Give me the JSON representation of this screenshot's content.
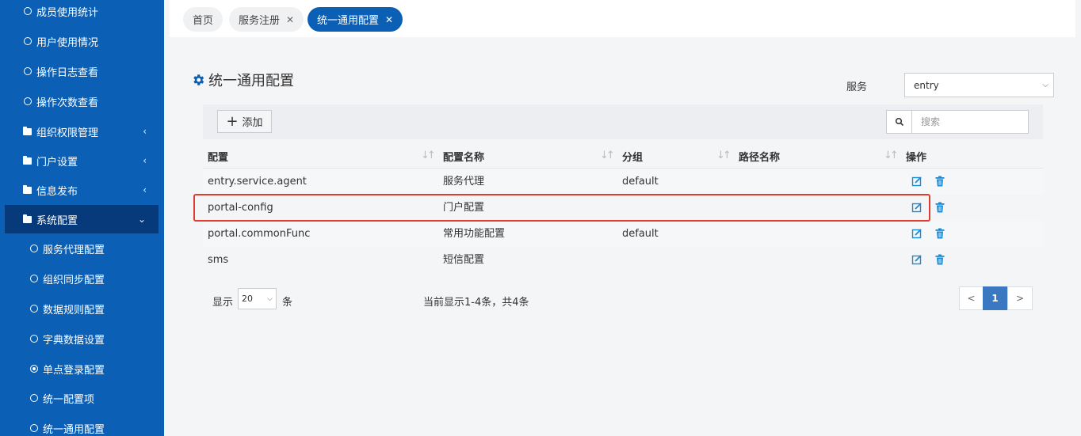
{
  "sidebar": {
    "items": [
      {
        "label": "成员使用统计",
        "type": "sub"
      },
      {
        "label": "用户使用情况",
        "type": "sub"
      },
      {
        "label": "操作日志查看",
        "type": "sub"
      },
      {
        "label": "操作次数查看",
        "type": "sub"
      },
      {
        "label": "组织权限管理",
        "type": "group",
        "chevron": "‹"
      },
      {
        "label": "门户设置",
        "type": "group",
        "chevron": "‹"
      },
      {
        "label": "信息发布",
        "type": "group",
        "chevron": "‹"
      },
      {
        "label": "系统配置",
        "type": "group",
        "chevron": "⌄",
        "active": true
      },
      {
        "label": "服务代理配置",
        "type": "sub2"
      },
      {
        "label": "组织同步配置",
        "type": "sub2"
      },
      {
        "label": "数据规则配置",
        "type": "sub2"
      },
      {
        "label": "字典数据设置",
        "type": "sub2"
      },
      {
        "label": "单点登录配置",
        "type": "sub2"
      },
      {
        "label": "统一配置项",
        "type": "sub2"
      },
      {
        "label": "统一通用配置",
        "type": "sub2"
      }
    ]
  },
  "tabs": [
    {
      "label": "首页",
      "closable": false
    },
    {
      "label": "服务注册",
      "closable": true
    },
    {
      "label": "统一通用配置",
      "closable": true,
      "active": true
    }
  ],
  "page": {
    "title": "统一通用配置",
    "service_label": "服务",
    "service_value": "entry",
    "add_label": "添加",
    "search_placeholder": "搜索"
  },
  "table": {
    "columns": [
      "配置",
      "配置名称",
      "分组",
      "路径名称",
      "操作"
    ],
    "rows": [
      {
        "key": "entry.service.agent",
        "name": "服务代理",
        "group": "default",
        "path": ""
      },
      {
        "key": "portal-config",
        "name": "门户配置",
        "group": "",
        "path": ""
      },
      {
        "key": "portal.commonFunc",
        "name": "常用功能配置",
        "group": "default",
        "path": ""
      },
      {
        "key": "sms",
        "name": "短信配置",
        "group": "",
        "path": ""
      }
    ]
  },
  "footer": {
    "show_label": "显示",
    "page_size": "20",
    "unit": "条",
    "summary": "当前显示1-4条，共4条",
    "prev": "<",
    "current_page": "1",
    "next": ">"
  },
  "colors": {
    "sidebar": "#0b5fb5",
    "accent": "#0b5fb5",
    "highlight": "#e23b2f",
    "action_icon": "#1a8ad4"
  }
}
